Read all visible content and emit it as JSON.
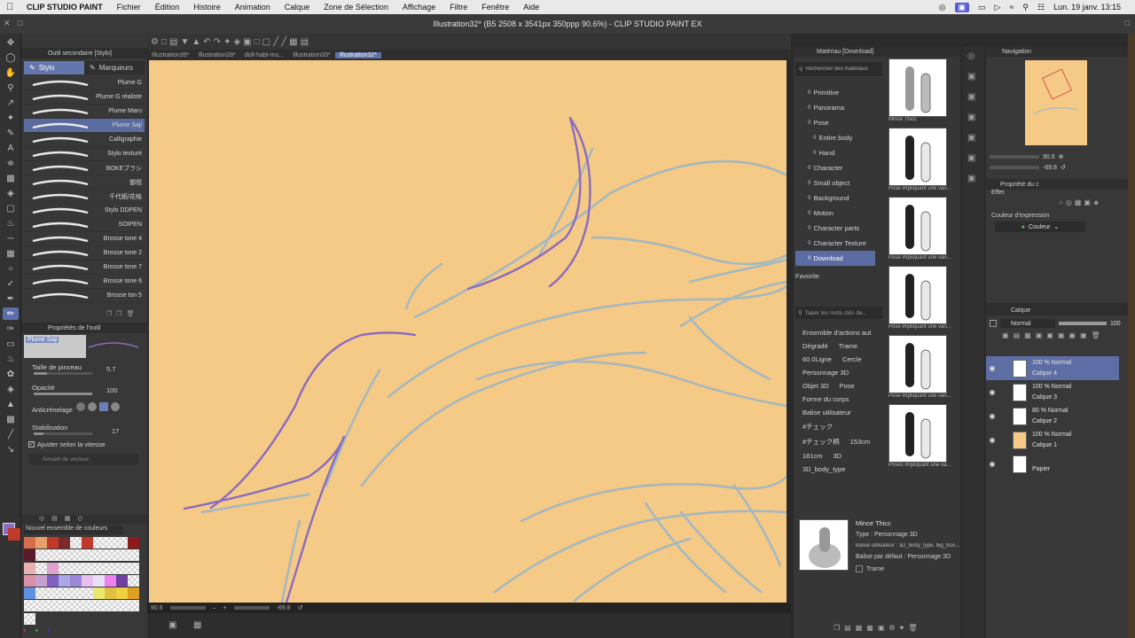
{
  "menubar": {
    "app_name": "CLIP STUDIO PAINT",
    "items": [
      "Fichier",
      "Édition",
      "Histoire",
      "Animation",
      "Calque",
      "Zone de Sélection",
      "Affichage",
      "Filtre",
      "Fenêtre",
      "Aide"
    ],
    "clock": "Lun. 19 janv.  13:15"
  },
  "window_title": "Illustration32* (B5 2508 x 3541px 350ppp 90.6%)  - CLIP STUDIO PAINT EX",
  "subtool": {
    "header": "Outil secondaire [Stylo]",
    "tabs": [
      "Stylo",
      "Marqueurs"
    ],
    "brushes": [
      "Plume G",
      "Plume G réaliste",
      "Plume Maru",
      "Plume Saji",
      "Calligraphie",
      "Stylo texturé",
      "BOKEブラシ",
      "御祖",
      "千代紙/花格",
      "Stylo DDPEN",
      "SOIPEN",
      "Brosse tone 4",
      "Brosse tone 2",
      "Brosse tone 7",
      "Brosse tone 6",
      "Brosse ton 5"
    ],
    "selected_brush": "Plume Saji"
  },
  "toolprops": {
    "header": "Propriétés de l'outil",
    "preview_label": "Plume Saji",
    "brush_size_label": "Taille de pinceau",
    "brush_size": "5.7",
    "opacity_label": "Opacité",
    "opacity": "100",
    "antialias_label": "Anticrénelage",
    "stabilization_label": "Stabilisation",
    "stabilization": "17",
    "speed_label": "Ajuster selon la vitesse",
    "vector_label": "Aimant de vecteur"
  },
  "palette": {
    "header": "Nouvel ensemble de couleurs",
    "main_color": "#8a6cc0",
    "sub_color": "#c0392b"
  },
  "doc_tabs": [
    "Illustration39*",
    "Illustration28*",
    "doll-habi-mu...",
    "Illustration33*",
    "Illustration32*"
  ],
  "active_doc_tab": "Illustration32*",
  "canvas": {
    "bg_color": "#f5c986",
    "zoom": "90.6",
    "angle": "-69.8"
  },
  "material": {
    "header": "Matériau [Download]",
    "search_placeholder": "Rechercher des matériaux",
    "tree": [
      "Primitive",
      "Panorama",
      "Pose",
      "Entire body",
      "Hand",
      "Character",
      "Small object",
      "Background",
      "Motion",
      "Character parts",
      "Character Texture",
      "Download"
    ],
    "favorite_label": "Favorite",
    "keyword_placeholder": "Taper les mots clés de...",
    "tags": [
      "Ensemble d'actions aut",
      "Dégradé",
      "Trame",
      "60.0Ligne",
      "Cercle",
      "Personnage 3D",
      "Objet 3D",
      "Pose",
      "Forme du corps",
      "Balise utilisateur",
      "#チェック",
      "#チェック柄",
      "153cm",
      "181cm",
      "3D",
      "3D_body_type"
    ],
    "thumbs": [
      "Mince Thicc",
      "Pose impliquant une vari...",
      "Pose impliquant une vari...",
      "Pose impliquant une vari...",
      "Pose impliquant une vari...",
      "Poses impliquant une va..."
    ],
    "detail": {
      "name": "Mince Thicc",
      "type": "Type : Personnage 3D",
      "user_tag": "Balise utilisateur : 3D_body_type, big_boo...",
      "default_tag": "Balise par défaut : Personnage 3D",
      "trame": "Trame"
    }
  },
  "navigation": {
    "header": "Navigation",
    "zoom": "90.6",
    "angle": "-69.8"
  },
  "layer_props": {
    "header": "Propriété du c",
    "effect_label": "Effet",
    "expression_label": "Couleur d'expression",
    "expression_value": "Couleur"
  },
  "layers": {
    "header": "Calque",
    "blend_mode": "Normal",
    "opacity": "100",
    "list": [
      {
        "line1": "100 % Normal",
        "line2": "Calque 4"
      },
      {
        "line1": "100 % Normal",
        "line2": "Calque 3"
      },
      {
        "line1": "80 % Normal",
        "line2": "Calque 2"
      },
      {
        "line1": "100 % Normal",
        "line2": "Calque 1"
      },
      {
        "line1": "",
        "line2": "Papier"
      }
    ]
  }
}
